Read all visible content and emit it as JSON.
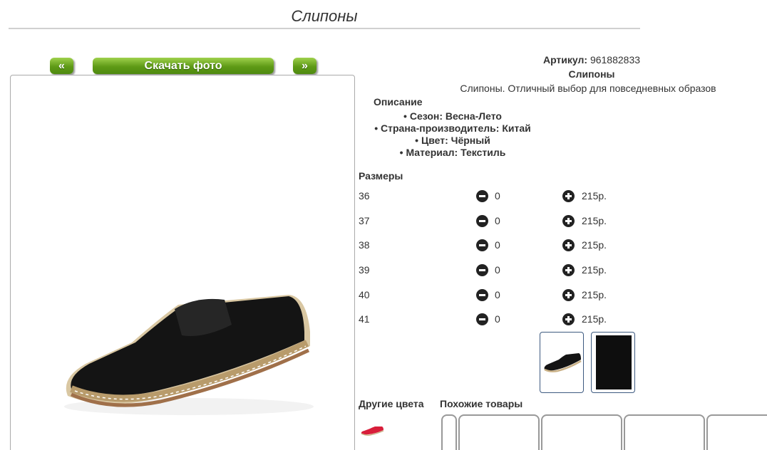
{
  "page": {
    "title": "Слипоны"
  },
  "nav": {
    "prev_label": "«",
    "download_label": "Скачать фото",
    "next_label": "»"
  },
  "product": {
    "sku_label": "Артикул:",
    "sku_value": "961882833",
    "name": "Слипоны",
    "description": "Слипоны. Отличный выбор для повседневных образов",
    "description_heading": "Описание",
    "properties": [
      "Сезон: Весна-Лето",
      "Страна-производитель: Китай",
      "Цвет: Чёрный",
      "Материал: Текстиль"
    ]
  },
  "sizes": {
    "heading": "Размеры",
    "rows": [
      {
        "size": "36",
        "qty": "0",
        "price": "215р."
      },
      {
        "size": "37",
        "qty": "0",
        "price": "215р."
      },
      {
        "size": "38",
        "qty": "0",
        "price": "215р."
      },
      {
        "size": "39",
        "qty": "0",
        "price": "215р."
      },
      {
        "size": "40",
        "qty": "0",
        "price": "215р."
      },
      {
        "size": "41",
        "qty": "0",
        "price": "215р."
      }
    ]
  },
  "sections": {
    "other_colors": "Другие цвета",
    "similar": "Похожие товары"
  },
  "colors": {
    "button_green": "#5e9a16",
    "thumb_border": "#3d5a80"
  }
}
